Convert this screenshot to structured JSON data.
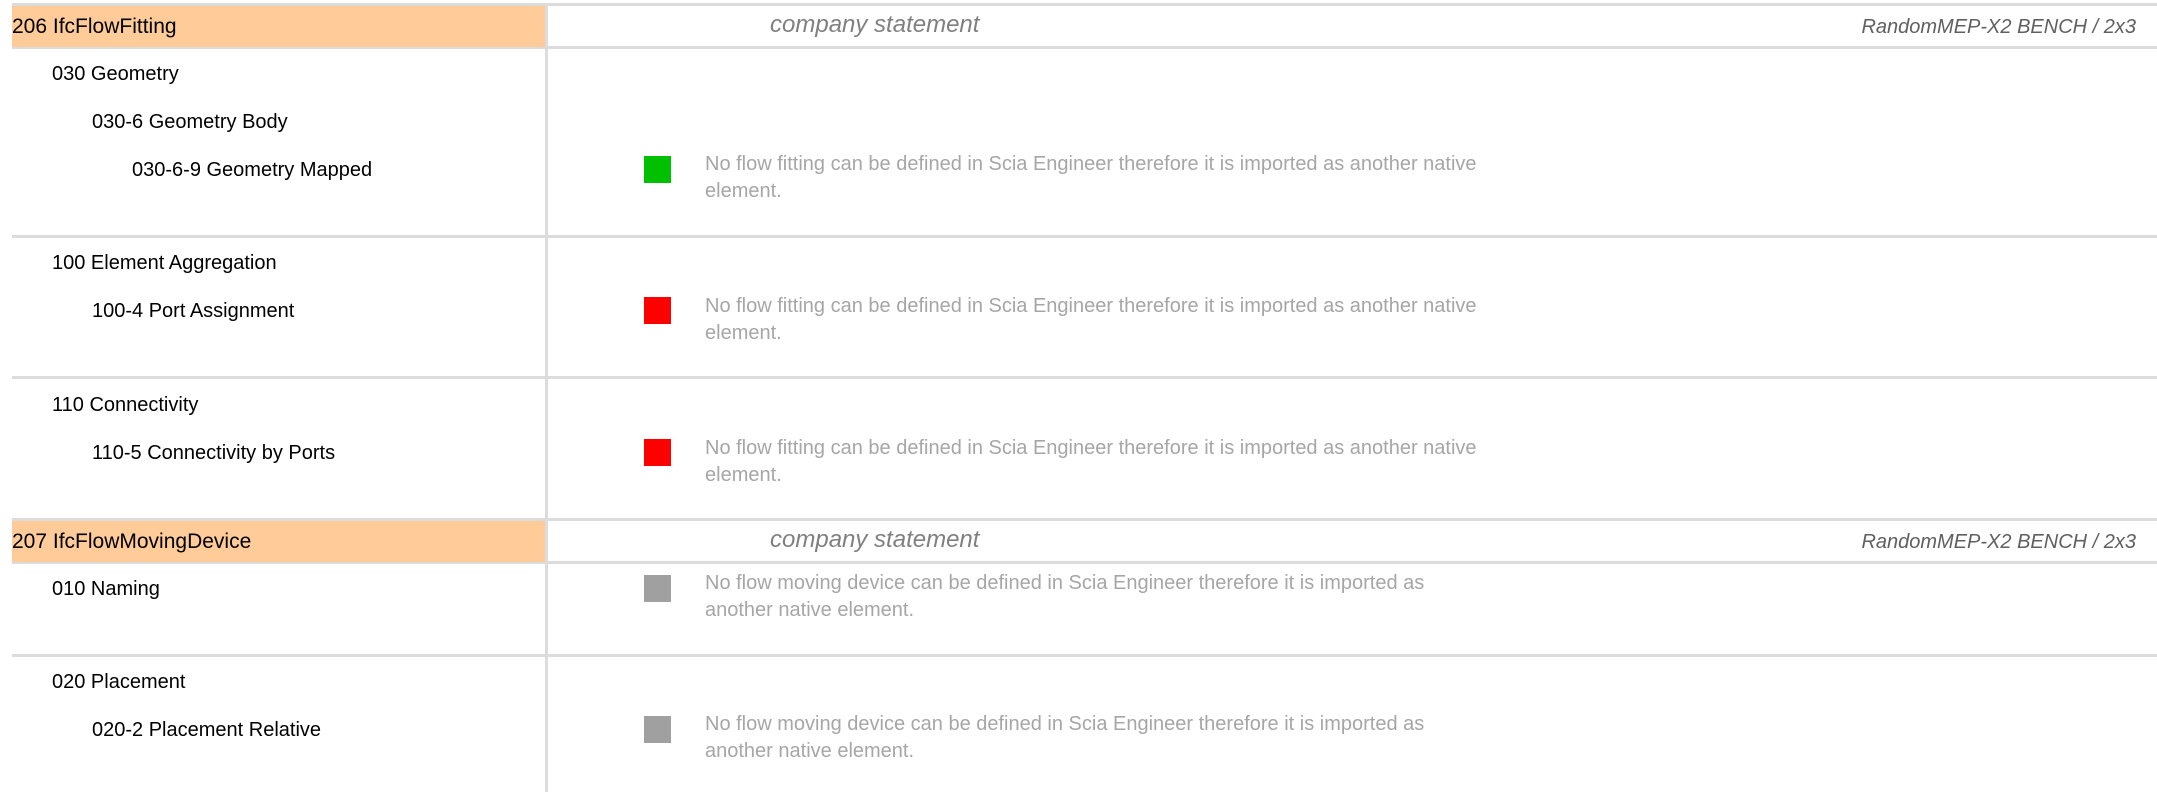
{
  "sections": [
    {
      "title": "206 IfcFlowFitting",
      "company": "company statement",
      "bench": "RandomMEP-X2 BENCH / 2x3"
    },
    {
      "title": "207 IfcFlowMovingDevice",
      "company": "company statement",
      "bench": "RandomMEP-X2 BENCH / 2x3"
    }
  ],
  "items": [
    {
      "label": "030 Geometry"
    },
    {
      "label": "030-6 Geometry Body"
    },
    {
      "label": "030-6-9 Geometry Mapped",
      "status_color": "#00c000",
      "note": "No flow fitting can be defined in Scia Engineer therefore it is imported as another native element."
    },
    {
      "label": "100 Element Aggregation"
    },
    {
      "label": "100-4 Port Assignment",
      "status_color": "#ff0000",
      "note": "No flow fitting can be defined in Scia Engineer therefore it is imported as another native element."
    },
    {
      "label": "110 Connectivity"
    },
    {
      "label": "110-5 Connectivity by Ports",
      "status_color": "#ff0000",
      "note": "No flow fitting can be defined in Scia Engineer therefore it is imported as another native element."
    },
    {
      "label": "010 Naming",
      "status_color": "#a0a0a0",
      "note": "No flow moving device can be defined in Scia Engineer therefore it is imported as another native element."
    },
    {
      "label": "020 Placement"
    },
    {
      "label": "020-2 Placement Relative",
      "status_color": "#a0a0a0",
      "note": "No flow moving device can be defined in Scia Engineer therefore it is imported as another native element."
    }
  ],
  "colors": {
    "section_header": "#ffcc99",
    "status_ok": "#00c000",
    "status_fail": "#ff0000",
    "status_na": "#a0a0a0",
    "note_text": "#a6a6a6"
  }
}
